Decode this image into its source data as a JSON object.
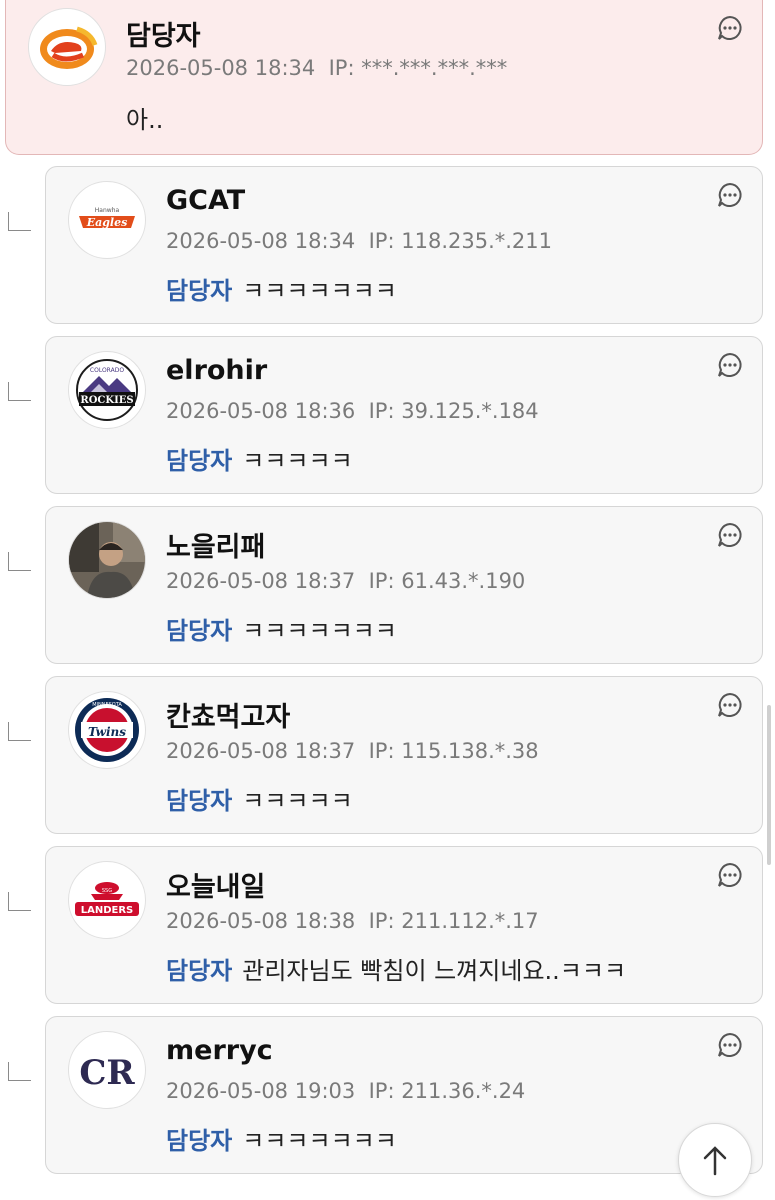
{
  "main_comment": {
    "author": "담당자",
    "date": "2026-05-08 18:34",
    "ip_label": "IP:",
    "ip": "***.***.***.***",
    "text": "아..",
    "avatar_icon": "eagle-e-logo-icon"
  },
  "replies": [
    {
      "author": "GCAT",
      "date": "2026-05-08 18:34",
      "ip_label": "IP:",
      "ip": "118.235.*.211",
      "mention": "담당자",
      "text": "ㅋㅋㅋㅋㅋㅋㅋ",
      "avatar_icon": "hanwha-eagles-logo-icon",
      "avatar_text": "Eagles",
      "avatar_small": "Hanwha"
    },
    {
      "author": "elrohir",
      "date": "2026-05-08 18:36",
      "ip_label": "IP:",
      "ip": "39.125.*.184",
      "mention": "담당자",
      "text": "ㅋㅋㅋㅋㅋ",
      "avatar_icon": "colorado-rockies-logo-icon",
      "avatar_text": "ROCKIES",
      "avatar_small": "COLORADO"
    },
    {
      "author": "노을리패",
      "date": "2026-05-08 18:37",
      "ip_label": "IP:",
      "ip": "61.43.*.190",
      "mention": "담당자",
      "text": "ㅋㅋㅋㅋㅋㅋㅋ",
      "avatar_icon": "person-photo-avatar-icon",
      "avatar_text": "",
      "avatar_small": ""
    },
    {
      "author": "칸쵸먹고자",
      "date": "2026-05-08 18:37",
      "ip_label": "IP:",
      "ip": "115.138.*.38",
      "mention": "담당자",
      "text": "ㅋㅋㅋㅋㅋ",
      "avatar_icon": "minnesota-twins-logo-icon",
      "avatar_text": "Twins",
      "avatar_small": "MINNESOTA"
    },
    {
      "author": "오늘내일",
      "date": "2026-05-08 18:38",
      "ip_label": "IP:",
      "ip": "211.112.*.17",
      "mention": "담당자",
      "text": "관리자님도 빡침이 느껴지네요..ㅋㅋㅋ",
      "avatar_icon": "ssg-landers-logo-icon",
      "avatar_text": "LANDERS",
      "avatar_small": "SSG"
    },
    {
      "author": "merryc",
      "date": "2026-05-08 19:03",
      "ip_label": "IP:",
      "ip": "211.36.*.24",
      "mention": "담당자",
      "text": "ㅋㅋㅋㅋㅋㅋㅋ",
      "avatar_icon": "cr-monogram-logo-icon",
      "avatar_text": "CR",
      "avatar_small": ""
    }
  ],
  "colors": {
    "mention": "#2f5fa8",
    "main_bg": "#fcecec",
    "reply_bg": "#f7f7f7"
  }
}
